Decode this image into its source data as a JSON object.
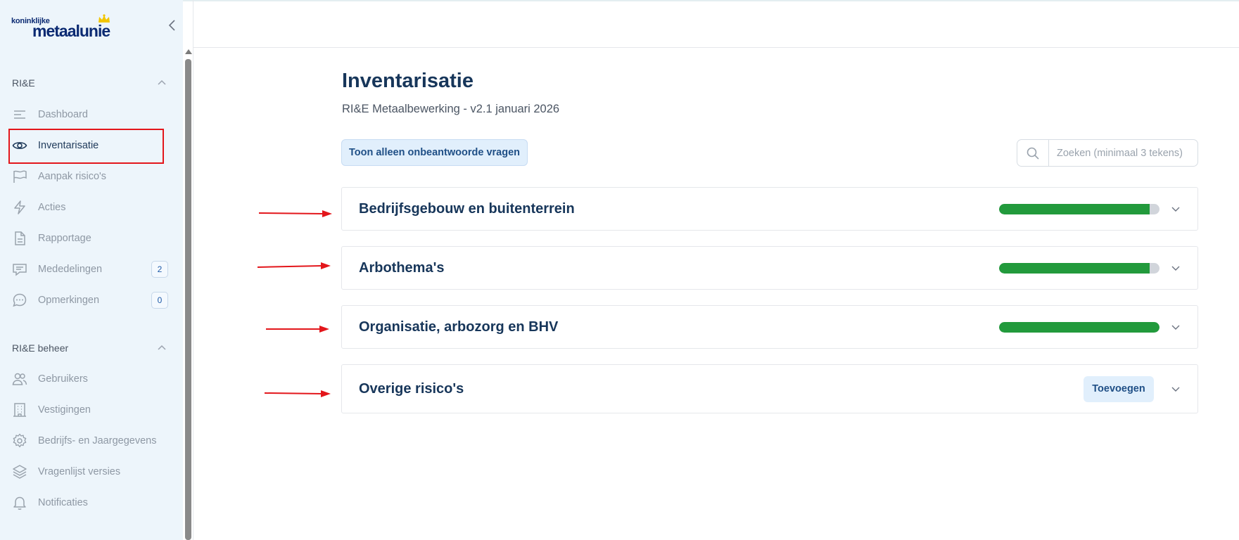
{
  "logo": {
    "top_text": "koninklijke",
    "main_text": "metaalunie"
  },
  "sidebar": {
    "sections": [
      {
        "title": "RI&E",
        "items": [
          {
            "label": "Dashboard",
            "icon": "menu-lines-icon"
          },
          {
            "label": "Inventarisatie",
            "icon": "eye-icon",
            "active": true
          },
          {
            "label": "Aanpak risico's",
            "icon": "flag-icon"
          },
          {
            "label": "Acties",
            "icon": "lightning-icon"
          },
          {
            "label": "Rapportage",
            "icon": "document-icon"
          },
          {
            "label": "Mededelingen",
            "icon": "message-icon",
            "badge": "2"
          },
          {
            "label": "Opmerkingen",
            "icon": "chat-dots-icon",
            "badge": "0"
          }
        ]
      },
      {
        "title": "RI&E beheer",
        "items": [
          {
            "label": "Gebruikers",
            "icon": "users-icon"
          },
          {
            "label": "Vestigingen",
            "icon": "building-icon"
          },
          {
            "label": "Bedrijfs- en Jaargegevens",
            "icon": "gear-icon"
          },
          {
            "label": "Vragenlijst versies",
            "icon": "layers-icon"
          },
          {
            "label": "Notificaties",
            "icon": "bell-icon"
          }
        ]
      }
    ]
  },
  "main": {
    "title": "Inventarisatie",
    "subtitle": "RI&E Metaalbewerking - v2.1 januari 2026",
    "filter_button": "Toon alleen onbeantwoorde vragen",
    "search": {
      "placeholder": "Zoeken (minimaal 3 tekens)",
      "value": ""
    },
    "categories": [
      {
        "title": "Bedrijfsgebouw en buitenterrein",
        "progress": 0.94
      },
      {
        "title": "Arbothema's",
        "progress": 0.94
      },
      {
        "title": "Organisatie, arbozorg en BHV",
        "progress": 1.0
      },
      {
        "title": "Overige risico's",
        "action": "Toevoegen"
      }
    ]
  },
  "colors": {
    "sidebar_bg": "#edf5fb",
    "heading": "#17365a",
    "progress": "#229a3c",
    "annotation": "#e3161b",
    "accent_button_bg": "#e1effc"
  }
}
